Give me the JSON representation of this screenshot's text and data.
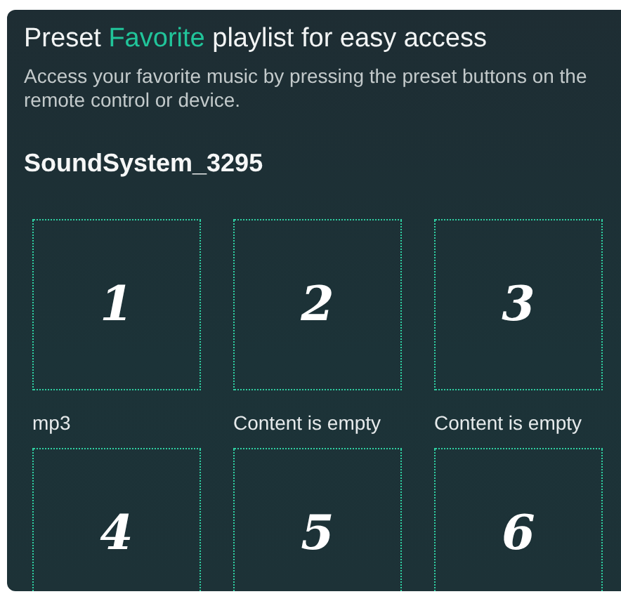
{
  "header": {
    "title_before": "Preset",
    "title_highlight": "Favorite",
    "title_after": "playlist for easy access",
    "description": "Access your favorite music by pressing the preset buttons on the remote control or device."
  },
  "device": {
    "name": "SoundSystem_3295"
  },
  "presets": [
    {
      "number": "1",
      "label": "mp3"
    },
    {
      "number": "2",
      "label": "Content is empty"
    },
    {
      "number": "3",
      "label": "Content is empty"
    },
    {
      "number": "4"
    },
    {
      "number": "5"
    },
    {
      "number": "6"
    }
  ]
}
